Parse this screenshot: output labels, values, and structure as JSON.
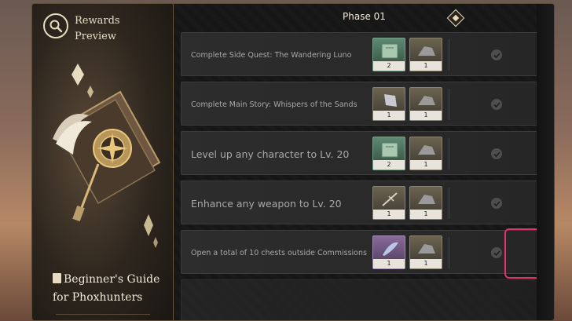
{
  "sidebar": {
    "rewards_line1": "Rewards",
    "rewards_line2": "Preview",
    "guide_line1": "Beginner's Guide",
    "guide_line2": "for Phoxhunters"
  },
  "phase": {
    "title": "Phase 01"
  },
  "tasks": [
    {
      "label": "Complete Side Quest: The Wandering Luno",
      "rewards": [
        {
          "count": "2",
          "color": "green"
        },
        {
          "count": "1",
          "color": "tan"
        }
      ]
    },
    {
      "label": "Complete Main Story: Whispers of the Sands",
      "rewards": [
        {
          "count": "1",
          "color": "tan"
        },
        {
          "count": "1",
          "color": "tan"
        }
      ]
    },
    {
      "label": "Level up any character to Lv. 20",
      "rewards": [
        {
          "count": "2",
          "color": "green"
        },
        {
          "count": "1",
          "color": "tan"
        }
      ]
    },
    {
      "label": "Enhance any weapon to Lv. 20",
      "rewards": [
        {
          "count": "1",
          "color": "tan"
        },
        {
          "count": "1",
          "color": "tan"
        }
      ]
    },
    {
      "label": "Open a total of 10 chests outside Commissions",
      "rewards": [
        {
          "count": "1",
          "color": "purple"
        },
        {
          "count": "1",
          "color": "tan"
        }
      ]
    }
  ],
  "icons": {
    "search": "magnifier-icon",
    "check": "check-icon",
    "guide": "book-icon"
  },
  "colors": {
    "highlight": "#e0356a",
    "accent": "#e8dcc0"
  }
}
